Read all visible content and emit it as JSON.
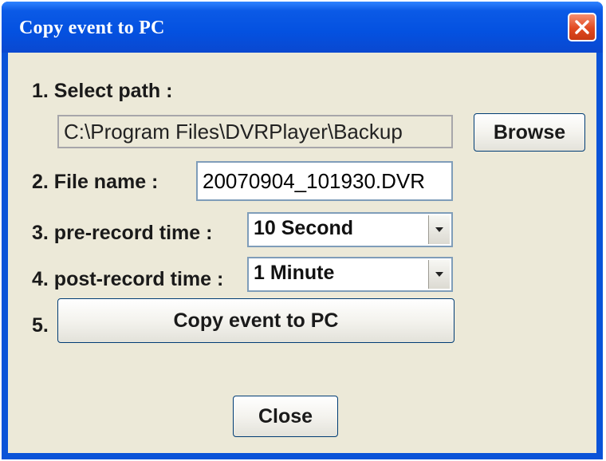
{
  "window": {
    "title": "Copy event to PC",
    "close_icon": "close-icon"
  },
  "dialog": {
    "step1_label": "1. Select path :",
    "path_value": "C:\\Program Files\\DVRPlayer\\Backup",
    "browse_label": "Browse",
    "step2_label": "2. File name :",
    "file_name_value": "20070904_101930.DVR",
    "step3_label": "3. pre-record time :",
    "pre_record_value": "10 Second",
    "step4_label": "4. post-record time :",
    "post_record_value": "1 Minute",
    "step5_label": "5.",
    "copy_button_label": "Copy event to PC",
    "close_button_label": "Close"
  },
  "colors": {
    "titlebar": "#0451e0",
    "dialog_bg": "#ece9d8",
    "close_button_bg": "#e14a21"
  }
}
